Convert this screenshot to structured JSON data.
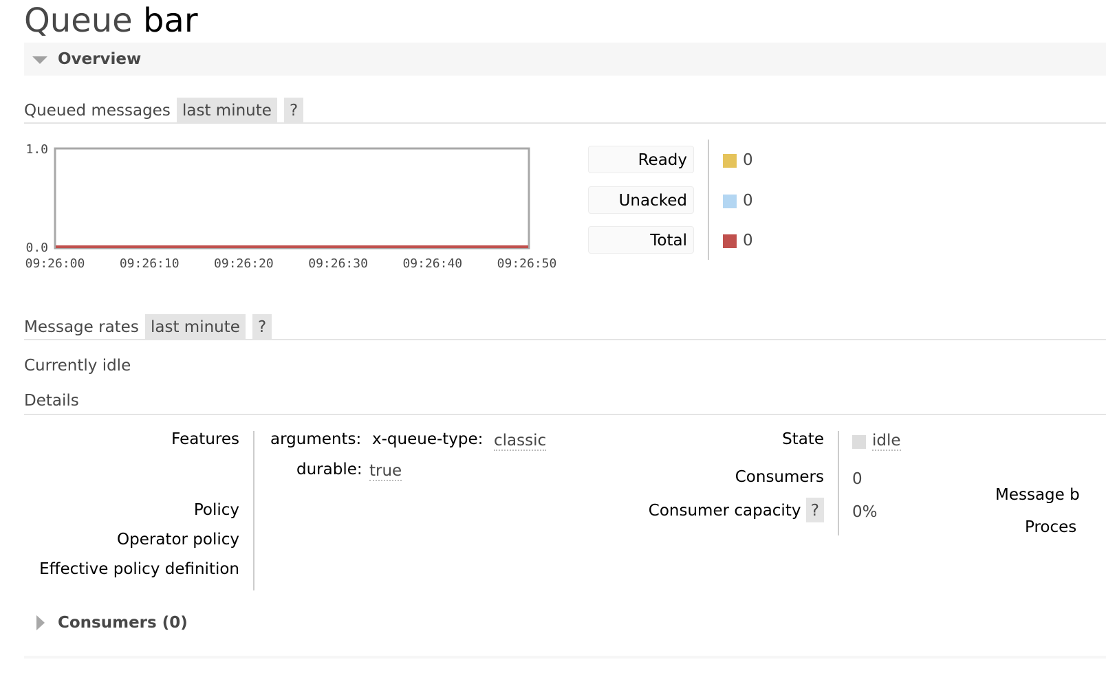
{
  "page": {
    "title_prefix": "Queue",
    "title_name": "bar"
  },
  "overview": {
    "title": "Overview"
  },
  "queued_messages": {
    "label": "Queued messages",
    "range": "last minute",
    "help": "?",
    "legend": [
      {
        "label": "Ready",
        "value": "0",
        "color": "#e5c35b"
      },
      {
        "label": "Unacked",
        "value": "0",
        "color": "#b3d6f2"
      },
      {
        "label": "Total",
        "value": "0",
        "color": "#c0504d"
      }
    ]
  },
  "chart_data": {
    "type": "line",
    "title": "Queued messages",
    "xlabel": "",
    "ylabel": "",
    "x": [
      "09:26:00",
      "09:26:10",
      "09:26:20",
      "09:26:30",
      "09:26:40",
      "09:26:50"
    ],
    "xticks": [
      "09:26:00",
      "09:26:10",
      "09:26:20",
      "09:26:30",
      "09:26:40",
      "09:26:50"
    ],
    "yticks": [
      "0.0",
      "1.0"
    ],
    "ylim": [
      0,
      1
    ],
    "grid": false,
    "series": [
      {
        "name": "Ready",
        "color": "#e5c35b",
        "values": [
          0,
          0,
          0,
          0,
          0,
          0
        ]
      },
      {
        "name": "Unacked",
        "color": "#b3d6f2",
        "values": [
          0,
          0,
          0,
          0,
          0,
          0
        ]
      },
      {
        "name": "Total",
        "color": "#c0504d",
        "values": [
          0,
          0,
          0,
          0,
          0,
          0
        ]
      }
    ],
    "legend": "right"
  },
  "message_rates": {
    "label": "Message rates",
    "range": "last minute",
    "help": "?",
    "status": "Currently idle"
  },
  "details": {
    "label": "Details",
    "features_label": "Features",
    "arguments_label": "arguments:",
    "queue_type_key": "x-queue-type:",
    "queue_type_value": "classic",
    "durable_key": "durable:",
    "durable_value": "true",
    "policy_label": "Policy",
    "operator_policy_label": "Operator policy",
    "effective_policy_label": "Effective policy definition",
    "state_label": "State",
    "state_value": "idle",
    "consumers_label": "Consumers",
    "consumers_value": "0",
    "consumer_capacity_label": "Consumer capacity",
    "consumer_capacity_help": "?",
    "consumer_capacity_value": "0%",
    "message_b_label": "Message b",
    "process_label": "Proces"
  },
  "consumers_section": {
    "title": "Consumers (0)"
  }
}
